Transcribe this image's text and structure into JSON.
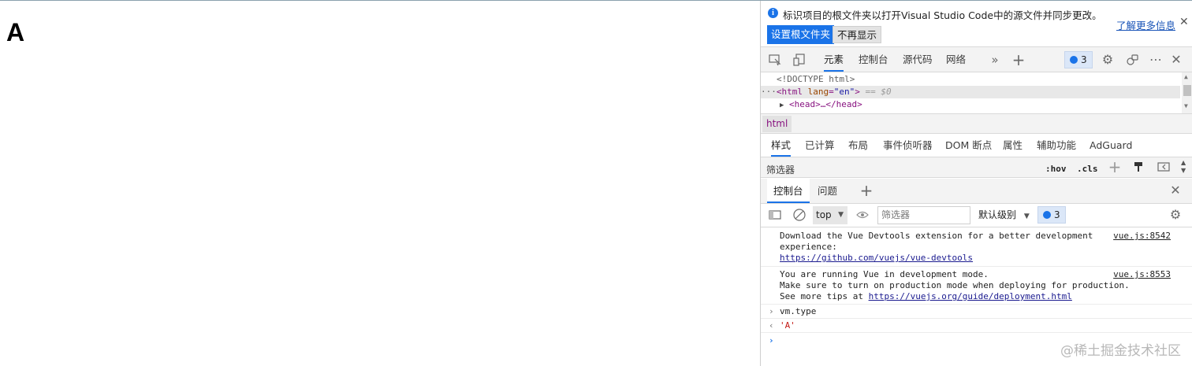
{
  "page": {
    "content_letter": "A"
  },
  "infobar": {
    "message": "标识项目的根文件夹以打开Visual Studio Code中的源文件并同步更改。",
    "learn_more": "了解更多信息",
    "set_root_button": "设置根文件夹",
    "dont_show_button": "不再显示"
  },
  "toolbar": {
    "tabs": [
      "元素",
      "控制台",
      "源代码",
      "网络"
    ],
    "active_tab": "元素",
    "issues_count": "3",
    "icons": [
      "inspect-icon",
      "device-icon",
      "more-tabs-icon",
      "add-tab-icon",
      "settings-icon",
      "connect-icon",
      "more-icon",
      "close-icon"
    ]
  },
  "elements": {
    "doctype": "<!DOCTYPE html>",
    "html_open": "<html",
    "attr_name": "lang",
    "attr_value": "\"en\"",
    "html_close_bracket": ">",
    "selected_marker": "== $0",
    "head": "<head>…</head>",
    "breadcrumb": "html"
  },
  "styles_tabs": [
    "样式",
    "已计算",
    "布局",
    "事件侦听器",
    "DOM 断点",
    "属性",
    "辅助功能",
    "AdGuard"
  ],
  "styles_filter": {
    "label": "筛选器",
    "hov": ":hov",
    "cls": ".cls"
  },
  "drawer": {
    "tabs": [
      "控制台",
      "问题"
    ]
  },
  "console_toolbar": {
    "context": "top",
    "filter_placeholder": "筛选器",
    "level": "默认级别",
    "issues_count": "3"
  },
  "console": {
    "messages": [
      {
        "line1": "Download the Vue Devtools extension for a better development",
        "line2": "experience:",
        "link": "https://github.com/vuejs/vue-devtools",
        "source": "vue.js:8542"
      },
      {
        "line1": "You are running Vue in development mode.",
        "line2": "Make sure to turn on production mode when deploying for production.",
        "line3_prefix": "See more tips at ",
        "link": "https://vuejs.org/guide/deployment.html",
        "source": "vue.js:8553"
      }
    ],
    "input": "vm.type",
    "output": "'A'"
  },
  "watermark": "@稀土掘金技术社区",
  "colors": {
    "accent": "#1a73e8",
    "tag": "#881280",
    "string": "#c41a16"
  }
}
